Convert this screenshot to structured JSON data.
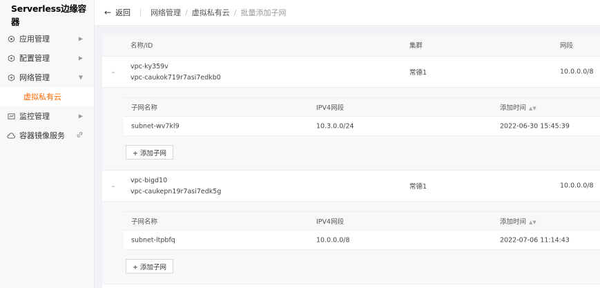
{
  "sidebar": {
    "title": "Serverless边缘容器",
    "items": [
      {
        "label": "应用管理",
        "icon": "app-icon",
        "arrow": "▶"
      },
      {
        "label": "配置管理",
        "icon": "config-icon",
        "arrow": "▶"
      },
      {
        "label": "网络管理",
        "icon": "network-icon",
        "arrow": "▼"
      },
      {
        "label": "监控管理",
        "icon": "monitor-icon",
        "arrow": "▶"
      },
      {
        "label": "容器镜像服务",
        "icon": "cloud-icon",
        "arrow": "link"
      }
    ],
    "active_sub": "虚拟私有云",
    "accent": "#ff6a00"
  },
  "header": {
    "back_label": "返回",
    "breadcrumb": [
      "网络管理",
      "虚拟私有云",
      "批量添加子网"
    ],
    "separator": "/"
  },
  "table": {
    "columns": [
      "名称/ID",
      "集群",
      "网段"
    ],
    "vpcs": [
      {
        "name": "vpc-ky359v",
        "id": "vpc-caukok719r7asi7edkb0",
        "cluster": "常德1",
        "cidr": "10.0.0.0/8",
        "subnet_columns": [
          "子网名称",
          "IPV4网段",
          "添加时间"
        ],
        "subnets": [
          {
            "name": "subnet-wv7kl9",
            "ipv4": "10.3.0.0/24",
            "time": "2022-06-30 15:45:39"
          }
        ],
        "add_label": "+ 添加子网"
      },
      {
        "name": "vpc-bigd10",
        "id": "vpc-caukepn19r7asi7edk5g",
        "cluster": "常德1",
        "cidr": "10.0.0.0/8",
        "subnet_columns": [
          "子网名称",
          "IPV4网段",
          "添加时间"
        ],
        "subnets": [
          {
            "name": "subnet-ltpbfq",
            "ipv4": "10.0.0.0/8",
            "time": "2022-07-06 11:14:43"
          }
        ],
        "add_label": "+ 添加子网"
      }
    ]
  }
}
